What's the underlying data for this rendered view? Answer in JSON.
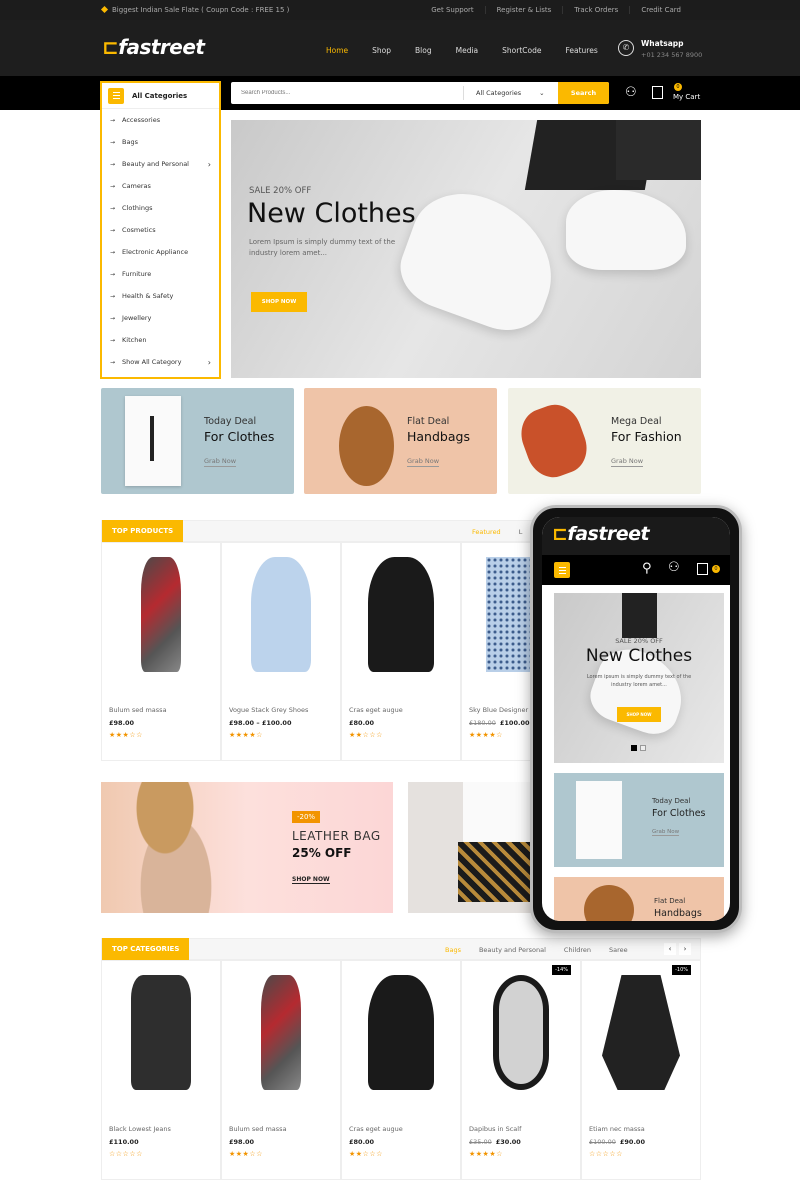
{
  "topbar": {
    "promo": "Biggest Indian Sale Flate ( Coupn Code : FREE 15 )",
    "links": [
      "Get Support",
      "Register & Lists",
      "Track Orders",
      "Credit Card"
    ]
  },
  "header": {
    "logo": "fastreet",
    "nav": [
      "Home",
      "Shop",
      "Blog",
      "Media",
      "ShortCode",
      "Features"
    ],
    "active_nav": "Home",
    "contact_label": "Whatsapp",
    "contact_phone": "+01 234 567 8900"
  },
  "navbar": {
    "categories_label": "All Categories",
    "search_placeholder": "Search Products...",
    "search_category": "All Categories",
    "search_button": "Search",
    "cart_count": "0",
    "cart_label": "My Cart"
  },
  "categories": [
    "Accessories",
    "Bags",
    "Beauty and Personal",
    "Cameras",
    "Clothings",
    "Cosmetics",
    "Electronic Appliance",
    "Furniture",
    "Health & Safety",
    "Jewellery",
    "Kitchen",
    "Show All Category"
  ],
  "hero": {
    "subtitle": "SALE 20% OFF",
    "title": "New Clothes",
    "text": "Lorem Ipsum is simply dummy text of the industry lorem amet...",
    "button": "SHOP NOW"
  },
  "deals": [
    {
      "t1": "Today Deal",
      "t2": "For Clothes",
      "link": "Grab Now",
      "bg": "#afc7cf"
    },
    {
      "t1": "Flat Deal",
      "t2": "Handbags",
      "link": "Grab Now",
      "bg": "#efc4a8"
    },
    {
      "t1": "Mega Deal",
      "t2": "For Fashion",
      "link": "Grab Now",
      "bg": "#f1f1e6"
    }
  ],
  "top_products": {
    "title": "TOP PRODUCTS",
    "tabs": [
      "Featured",
      "L"
    ],
    "items": [
      {
        "name": "Bulum sed massa",
        "price": "£98.00",
        "old": "",
        "rating": 3
      },
      {
        "name": "Vogue Stack Grey Shoes",
        "price": "£98.00 – £100.00",
        "old": "",
        "rating": 4
      },
      {
        "name": "Cras eget augue",
        "price": "£80.00",
        "old": "",
        "rating": 2
      },
      {
        "name": "Sky Blue Designer",
        "price": "£100.00",
        "old": "£180.00",
        "rating": 4
      }
    ]
  },
  "banner": {
    "badge": "-20%",
    "title": "LEATHER BAG",
    "subtitle": "25% OFF",
    "link": "SHOP NOW"
  },
  "top_categories": {
    "title": "TOP CATEGORIES",
    "tabs": [
      "Bags",
      "Beauty and Personal",
      "Children",
      "Saree"
    ],
    "items": [
      {
        "name": "Black Lowest Jeans",
        "price": "£110.00",
        "old": "",
        "rating": 0,
        "badge": ""
      },
      {
        "name": "Bulum sed massa",
        "price": "£98.00",
        "old": "",
        "rating": 3,
        "badge": ""
      },
      {
        "name": "Cras eget augue",
        "price": "£80.00",
        "old": "",
        "rating": 2,
        "badge": ""
      },
      {
        "name": "Dapibus in Scalf",
        "price": "£30.00",
        "old": "£35.00",
        "rating": 4,
        "badge": "-14%"
      },
      {
        "name": "Etiam nec massa",
        "price": "£90.00",
        "old": "£100.00",
        "rating": 0,
        "badge": "-10%"
      }
    ]
  },
  "phone": {
    "logo": "fastreet",
    "cart_count": "0",
    "hero_subtitle": "SALE 20% OFF",
    "hero_title": "New Clothes",
    "hero_text": "Lorem ipsum is simply dummy text of the industry lorem amet...",
    "hero_button": "SHOP NOW",
    "deal1_t1": "Today Deal",
    "deal1_t2": "For Clothes",
    "deal1_link": "Grab Now",
    "deal2_t1": "Flat Deal",
    "deal2_t2": "Handbags"
  },
  "colors": {
    "accent": "#fbb900",
    "dark": "#1e1e1e",
    "star": "#f29400"
  }
}
